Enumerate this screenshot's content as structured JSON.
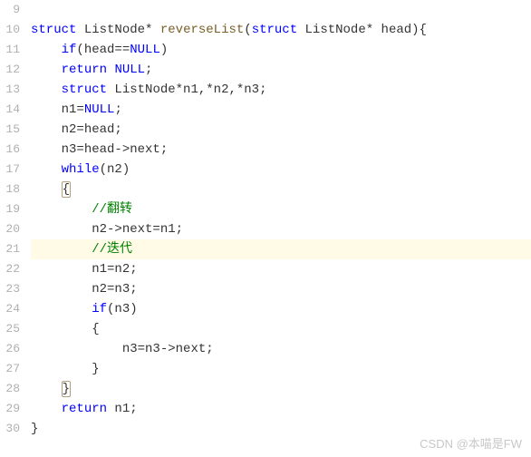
{
  "line_numbers": [
    "9",
    "10",
    "11",
    "12",
    "13",
    "14",
    "15",
    "16",
    "17",
    "18",
    "19",
    "20",
    "21",
    "22",
    "23",
    "24",
    "25",
    "26",
    "27",
    "28",
    "29",
    "30"
  ],
  "code": {
    "l10": {
      "kw": "struct",
      "type": " ListNode",
      "star": "* ",
      "fn": "reverseList",
      "open": "(",
      "kw2": "struct",
      "type2": " ListNode",
      "star2": "* ",
      "param": "head",
      "close": "){"
    },
    "l11": {
      "indent": "    ",
      "kw": "if",
      "text": "(head==",
      "null": "NULL",
      "close": ")"
    },
    "l12": {
      "indent": "    ",
      "kw": "return",
      "sp": " ",
      "null": "NULL",
      "semi": ";"
    },
    "l13": {
      "indent": "    ",
      "kw": "struct",
      "type": " ListNode",
      "text": "*n1,*n2,*n3;"
    },
    "l14": {
      "indent": "    ",
      "text": "n1=",
      "null": "NULL",
      "semi": ";"
    },
    "l15": {
      "indent": "    ",
      "text": "n2=head;"
    },
    "l16": {
      "indent": "    ",
      "text": "n3=head->next;"
    },
    "l17": {
      "indent": "    ",
      "kw": "while",
      "text": "(n2)"
    },
    "l18": {
      "indent": "    ",
      "brace": "{"
    },
    "l19": {
      "indent": "        ",
      "comment": "//翻转"
    },
    "l20": {
      "indent": "        ",
      "text": "n2->next=n1;"
    },
    "l21": {
      "indent": "        ",
      "comment": "//迭代"
    },
    "l22": {
      "indent": "        ",
      "text": "n1=n2;"
    },
    "l23": {
      "indent": "        ",
      "text": "n2=n3;"
    },
    "l24": {
      "indent": "        ",
      "kw": "if",
      "text": "(n3)"
    },
    "l25": {
      "indent": "        ",
      "brace": "{"
    },
    "l26": {
      "indent": "            ",
      "text": "n3=n3->next;"
    },
    "l27": {
      "indent": "        ",
      "brace": "}"
    },
    "l28": {
      "indent": "    ",
      "brace": "}"
    },
    "l29": {
      "indent": "    ",
      "kw": "return",
      "text": " n1;"
    },
    "l30": {
      "brace": "}"
    }
  },
  "watermark": "CSDN @本喵是FW"
}
